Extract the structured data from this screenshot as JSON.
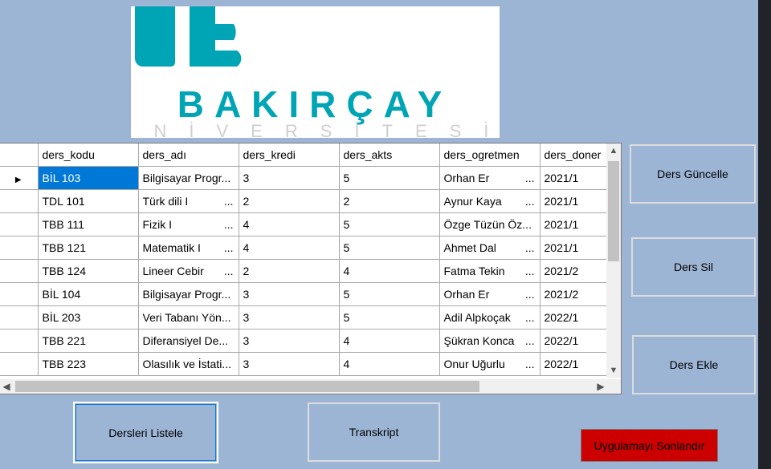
{
  "logo": {
    "name": "BAKIRÇAY",
    "subtitle": "ÜNİVERSİTESİ",
    "color": "#00a5b5"
  },
  "grid": {
    "columns": [
      "ders_kodu",
      "ders_adı",
      "ders_kredi",
      "ders_akts",
      "ders_ogretmen",
      "ders_doner"
    ],
    "rows": [
      {
        "kod": "BİL 103",
        "ad": "Bilgisayar Progr...",
        "kredi": "3",
        "akts": "5",
        "ogretmen": "Orhan Er",
        "ogr_ell": "...",
        "donem": "2021/1"
      },
      {
        "kod": "TDL 101",
        "ad": "Türk dili I",
        "ad_ell": "...",
        "kredi": "2",
        "akts": "2",
        "ogretmen": "Aynur Kaya",
        "ogr_ell": "...",
        "donem": "2021/1"
      },
      {
        "kod": "TBB 111",
        "ad": "Fizik I",
        "ad_ell": "...",
        "kredi": "4",
        "akts": "5",
        "ogretmen": "Özge Tüzün Öz...",
        "donem": "2021/1"
      },
      {
        "kod": "TBB 121",
        "ad": "Matematik I",
        "ad_ell": "...",
        "kredi": "4",
        "akts": "5",
        "ogretmen": "Ahmet Dal",
        "ogr_ell": "...",
        "donem": "2021/1"
      },
      {
        "kod": "TBB 124",
        "ad": "Lineer Cebir",
        "ad_ell": "...",
        "kredi": "2",
        "akts": "4",
        "ogretmen": "Fatma Tekin",
        "ogr_ell": "...",
        "donem": "2021/2"
      },
      {
        "kod": "BİL 104",
        "ad": "Bilgisayar Progr...",
        "kredi": "3",
        "akts": "5",
        "ogretmen": "Orhan Er",
        "ogr_ell": "...",
        "donem": "2021/2"
      },
      {
        "kod": "BİL 203",
        "ad": "Veri Tabanı Yön...",
        "kredi": "3",
        "akts": "5",
        "ogretmen": "Adil Alpkoçak",
        "ogr_ell": "...",
        "donem": "2022/1"
      },
      {
        "kod": "TBB 221",
        "ad": "Diferansiyel De...",
        "kredi": "3",
        "akts": "4",
        "ogretmen": "Şükran Konca",
        "ogr_ell": "...",
        "donem": "2022/1"
      },
      {
        "kod": "TBB 223",
        "ad": "Olasılık ve İstati...",
        "kredi": "3",
        "akts": "4",
        "ogretmen": "Onur Uğurlu",
        "ogr_ell": "...",
        "donem": "2022/1"
      }
    ]
  },
  "buttons": {
    "guncelle": "Ders Güncelle",
    "sil": "Ders Sil",
    "ekle": "Ders Ekle",
    "listele": "Dersleri Listele",
    "transkript": "Transkript",
    "sonlandir": "Uygulamayı Sonlandır"
  },
  "colors": {
    "background": "#9db5d5",
    "selection": "#0078d7",
    "exit_button": "#cc0000"
  }
}
